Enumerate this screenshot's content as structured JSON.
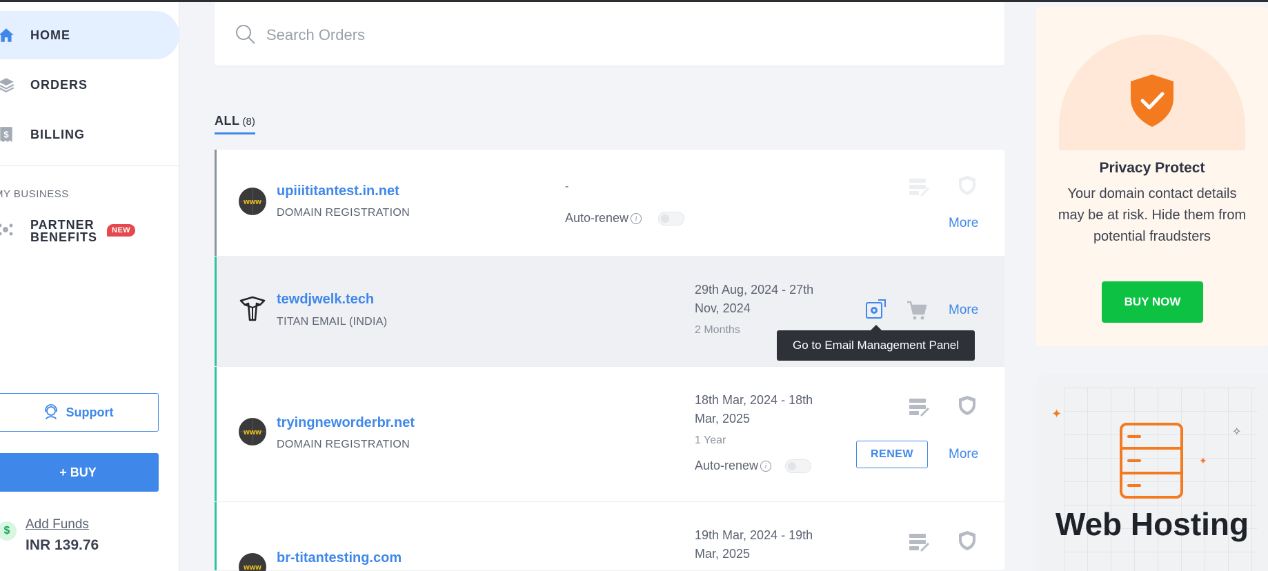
{
  "sidebar": {
    "nav": [
      {
        "label": "HOME",
        "icon": "home-icon",
        "active": true
      },
      {
        "label": "ORDERS",
        "icon": "layers-icon",
        "active": false
      },
      {
        "label": "BILLING",
        "icon": "receipt-icon",
        "active": false
      }
    ],
    "section_title": "MY BUSINESS",
    "partner": {
      "label": "PARTNER BENEFITS",
      "badge": "NEW"
    },
    "support_label": "Support",
    "buy_label": "+ BUY",
    "add_funds_label": "Add Funds",
    "balance": "INR 139.76"
  },
  "search": {
    "placeholder": "Search Orders"
  },
  "tabs": {
    "all_label": "ALL",
    "all_count": "(8)"
  },
  "orders": [
    {
      "name": "upiiititantest.in.net",
      "type": "DOMAIN REGISTRATION",
      "dates": "-",
      "autorenew_label": "Auto-renew",
      "more_label": "More"
    },
    {
      "name": "tewdjwelk.tech",
      "type": "TITAN EMAIL (INDIA)",
      "dates": "29th Aug, 2024 - 27th Nov, 2024",
      "duration": "2 Months",
      "more_label": "More",
      "tooltip": "Go to Email Management Panel"
    },
    {
      "name": "tryingneworderbr.net",
      "type": "DOMAIN REGISTRATION",
      "dates": "18th Mar, 2024 - 18th Mar, 2025",
      "duration": "1 Year",
      "autorenew_label": "Auto-renew",
      "renew_label": "RENEW",
      "more_label": "More"
    },
    {
      "name": "br-titantesting.com",
      "dates": "19th Mar, 2024 - 19th Mar, 2025"
    }
  ],
  "promo_privacy": {
    "title": "Privacy Protect",
    "description": "Your domain contact details may be at risk. Hide them from potential fraudsters",
    "button": "BUY NOW"
  },
  "promo_hosting": {
    "title": "Web Hosting"
  },
  "colors": {
    "accent": "#3f88ea",
    "active_stripe": "#2ec4a0",
    "buy_now": "#0dc243",
    "shield": "#f47a20"
  }
}
